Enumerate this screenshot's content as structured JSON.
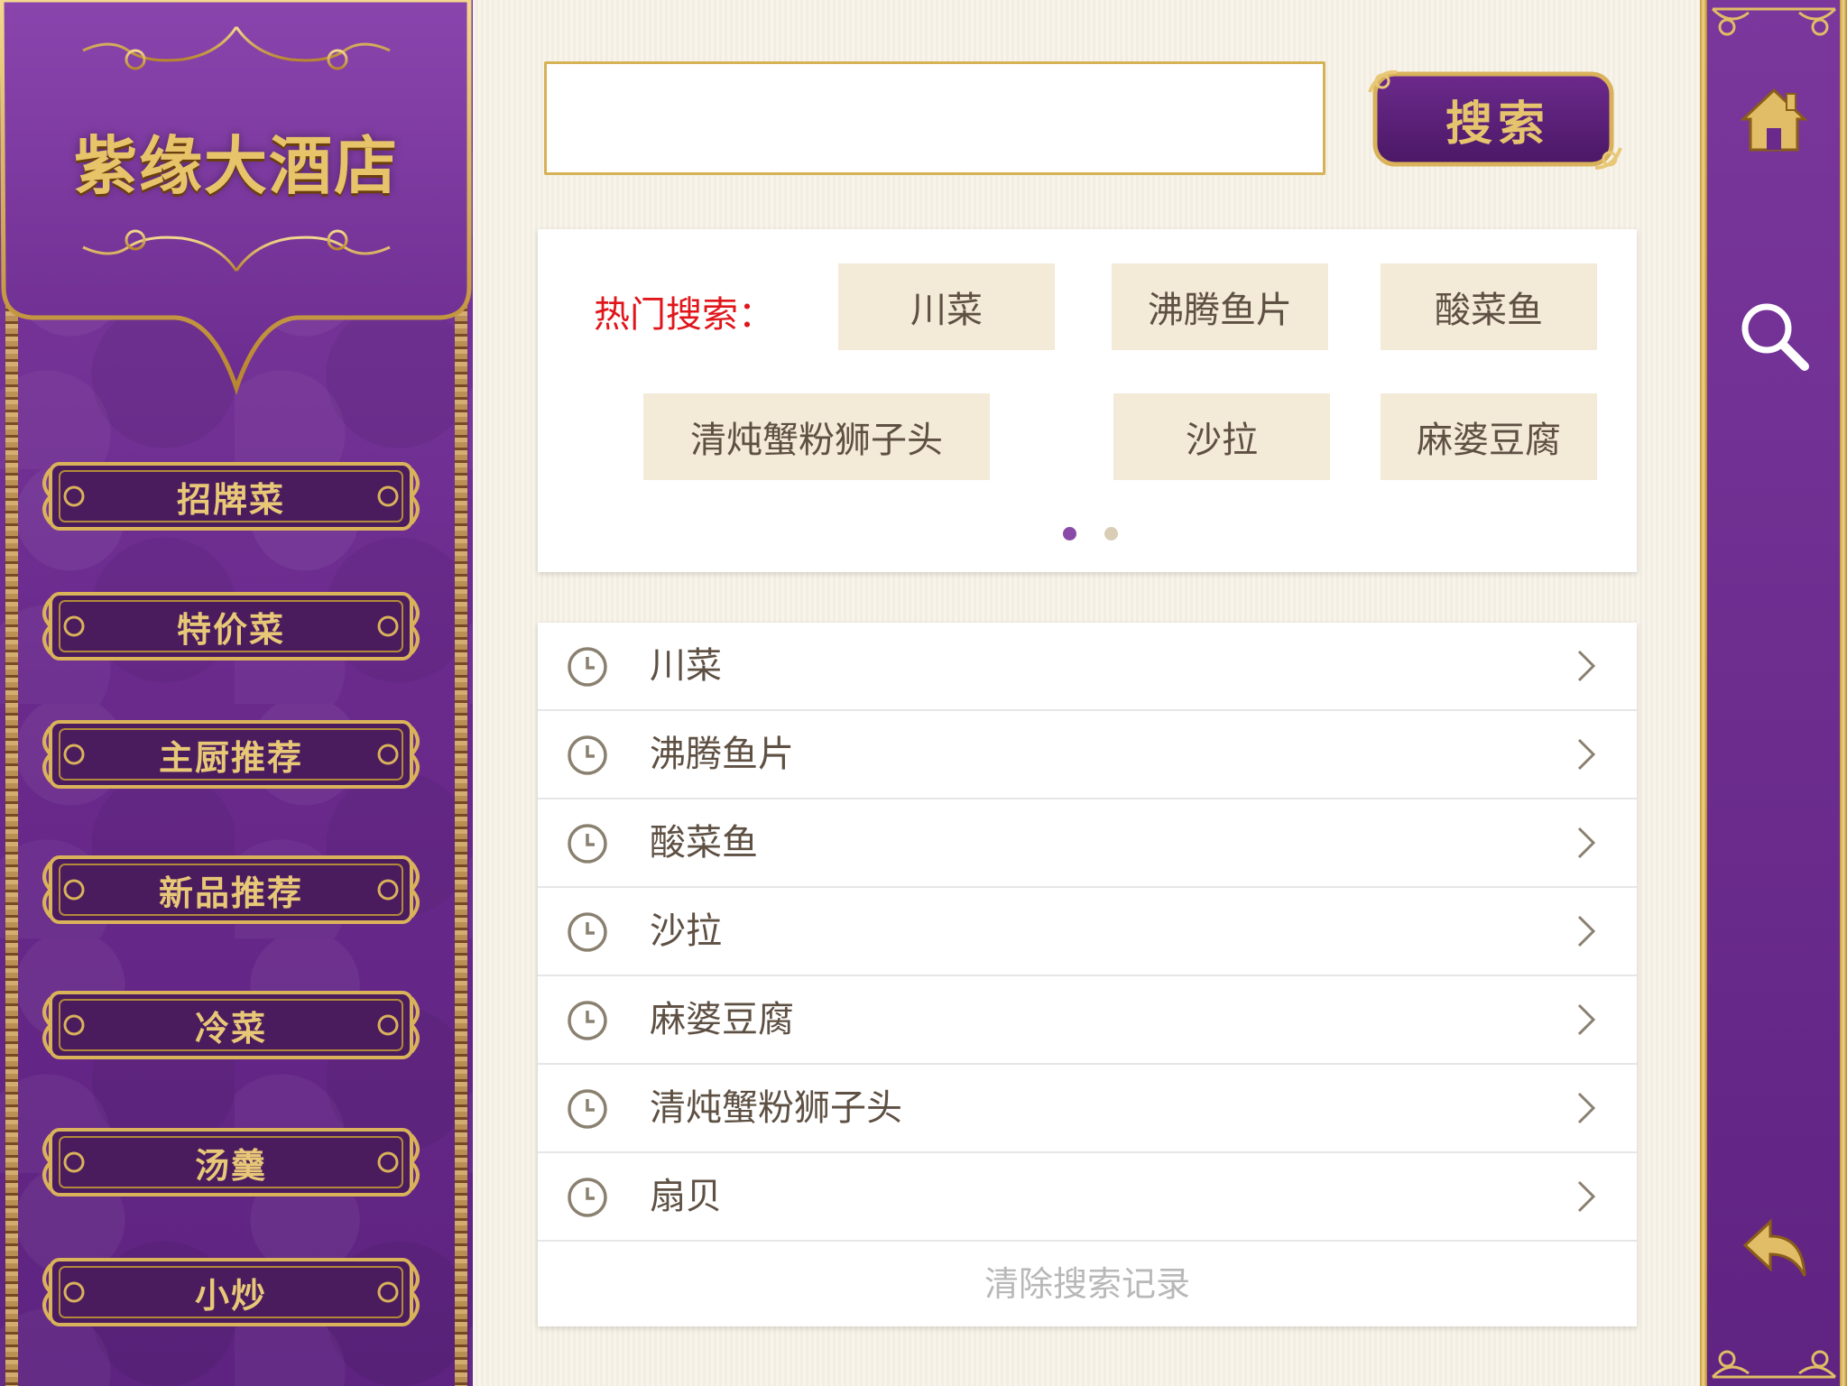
{
  "brand": {
    "title": "紫缘大酒店"
  },
  "sidebar": {
    "items": [
      {
        "label": "招牌菜"
      },
      {
        "label": "特价菜"
      },
      {
        "label": "主厨推荐"
      },
      {
        "label": "新品推荐"
      },
      {
        "label": "冷菜"
      },
      {
        "label": "汤羹"
      },
      {
        "label": "小炒"
      }
    ]
  },
  "search": {
    "value": "",
    "placeholder": "",
    "button_label": "搜索"
  },
  "hot": {
    "label": "热门搜索：",
    "tags": [
      "川菜",
      "沸腾鱼片",
      "酸菜鱼",
      "清炖蟹粉狮子头",
      "沙拉",
      "麻婆豆腐"
    ],
    "page_count": 2,
    "current_page": 1
  },
  "history": {
    "items": [
      "川菜",
      "沸腾鱼片",
      "酸菜鱼",
      "沙拉",
      "麻婆豆腐",
      "清炖蟹粉狮子头",
      "扇贝"
    ],
    "clear_label": "清除搜索记录"
  },
  "rightbar": {
    "icons": [
      "home-icon",
      "search-icon",
      "back-icon"
    ]
  },
  "colors": {
    "purple": "#6a2a8c",
    "gold": "#d6b257",
    "hot_label": "#e0161b",
    "tag_bg": "#f3ead8",
    "dot_active": "#8a4aa8",
    "dot_inactive": "#d9cdb6"
  }
}
